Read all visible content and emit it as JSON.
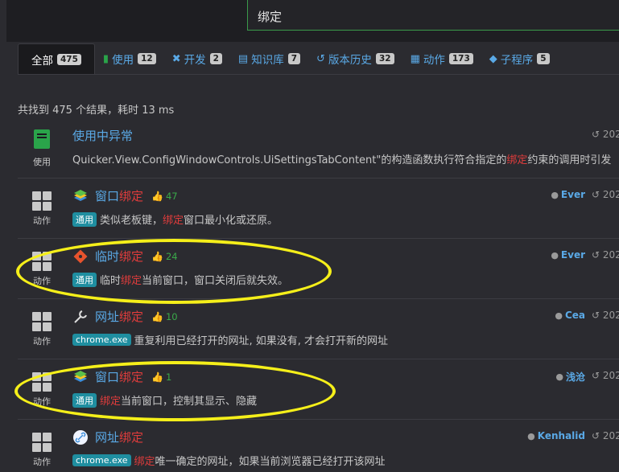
{
  "search": {
    "value": "绑定"
  },
  "tabs": [
    {
      "icon": "",
      "label": "全部",
      "count": "475",
      "active": true
    },
    {
      "icon": "▮",
      "label": "使用",
      "count": "12"
    },
    {
      "icon": "✖",
      "label": "开发",
      "count": "2"
    },
    {
      "icon": "▤",
      "label": "知识库",
      "count": "7"
    },
    {
      "icon": "↺",
      "label": "版本历史",
      "count": "32"
    },
    {
      "icon": "▦",
      "label": "动作",
      "count": "173"
    },
    {
      "icon": "◆",
      "label": "子程序",
      "count": "5"
    }
  ],
  "summary": "共找到 475 个结果，耗时 13 ms",
  "results": [
    {
      "kind": "使用",
      "title_main": "使用中异常",
      "title_hl": "",
      "desc_pre": "Quicker.View.ConfigWindowControls.UiSettingsTabContent\"的构造函数执行符合指定的",
      "desc_hl": "绑定",
      "desc_post": "约束的调用时引发",
      "date": "202"
    },
    {
      "kind": "动作",
      "icon": "bluestacks-icon",
      "title_main": "窗口",
      "title_hl": "绑定",
      "likes": "47",
      "badge": "通用",
      "desc_pre": "类似老板键，",
      "desc_hl": "绑定",
      "desc_post": "窗口最小化或还原。",
      "author": "Ever",
      "date": "202"
    },
    {
      "kind": "动作",
      "icon": "git-icon",
      "title_main": "临时",
      "title_hl": "绑定",
      "likes": "24",
      "badge": "通用",
      "desc_pre": "临时",
      "desc_hl": "绑定",
      "desc_post": "当前窗口，窗口关闭后就失效。",
      "author": "Ever",
      "date": "202"
    },
    {
      "kind": "动作",
      "icon": "wrench-icon",
      "title_main": "网址",
      "title_hl": "绑定",
      "likes": "10",
      "badge": "chrome.exe",
      "desc_pre": "重复利用已经打开的网址, 如果没有, 才会打开新的网址",
      "desc_hl": "",
      "desc_post": "",
      "author": "Cea",
      "date": "202"
    },
    {
      "kind": "动作",
      "icon": "bluestacks-icon",
      "title_main": "窗口",
      "title_hl": "绑定",
      "likes": "1",
      "badge": "通用",
      "desc_pre": "",
      "desc_hl": "绑定",
      "desc_post": "当前窗口，控制其显示、隐藏",
      "author": "浅沧",
      "date": "202"
    },
    {
      "kind": "动作",
      "icon": "link-icon",
      "title_main": "网址",
      "title_hl": "绑定",
      "badge": "chrome.exe",
      "desc_pre": "",
      "desc_hl": "绑定",
      "desc_post": "唯一确定的网址，如果当前浏览器已经打开该网址",
      "author": "Kenhalid",
      "date": "202"
    }
  ],
  "colors": {
    "accent": "#5aa9e6",
    "highlight": "#e03c3c",
    "annotation": "#f5ef1a",
    "badge": "#1f8ea0"
  }
}
